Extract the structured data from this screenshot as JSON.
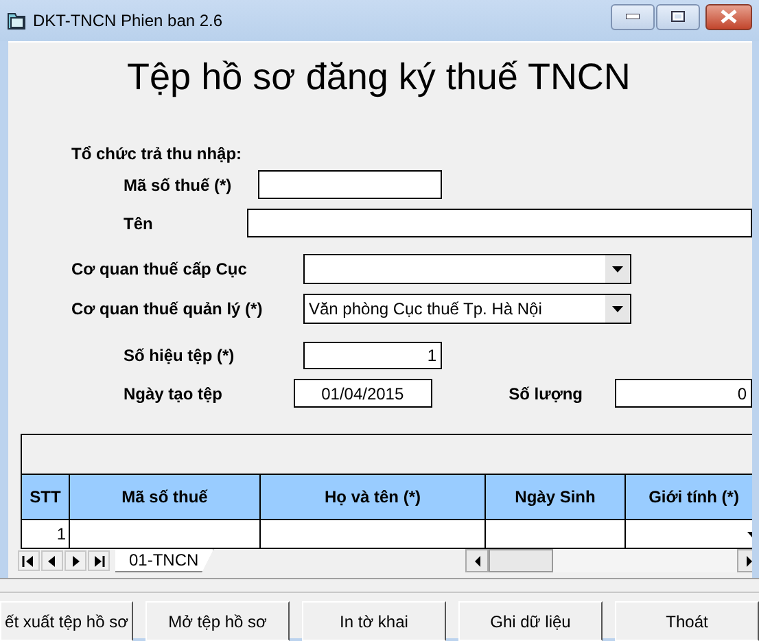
{
  "window": {
    "title": "DKT-TNCN Phien ban 2.6"
  },
  "heading": "Tệp hồ sơ đăng ký thuế TNCN",
  "payer": {
    "label": "Tổ chức trả thu nhập:",
    "fields": [
      {
        "label": "Mã số thuế (*)",
        "kind": "text"
      },
      {
        "label": "Tên",
        "kind": "wide"
      }
    ]
  },
  "tax_office": [
    {
      "label": "Cơ quan thuế cấp Cục",
      "kind": "select"
    },
    {
      "label": "Cơ quan thuế quản lý (*)",
      "kind": "select",
      "value": "Văn phòng Cục thuế Tp. Hà Nội"
    }
  ],
  "file": {
    "number": {
      "label": "Số hiệu tệp (*)",
      "value": "1"
    },
    "created": {
      "label": "Ngày tạo tệp",
      "value": "01/04/2015"
    },
    "count": {
      "label": "Số lượng",
      "value": "0"
    }
  },
  "table": {
    "columns": [
      {
        "label": "STT",
        "kind": "text"
      },
      {
        "label": "Mã số thuế",
        "kind": "text"
      },
      {
        "label": "Họ và tên (*)",
        "kind": "text"
      },
      {
        "label": "Ngày Sinh",
        "kind": "text"
      },
      {
        "label": "Giới tính (*)",
        "kind": "select"
      }
    ],
    "rows": [
      {
        "stt": "1"
      }
    ]
  },
  "sheet_tabs": [
    {
      "label": "01-TNCN",
      "selected": true
    }
  ],
  "buttons": [
    "ết xuất tệp hồ sơ",
    "Mở tệp hồ sơ",
    "In tờ khai",
    "Ghi dữ liệu",
    "Thoát"
  ]
}
